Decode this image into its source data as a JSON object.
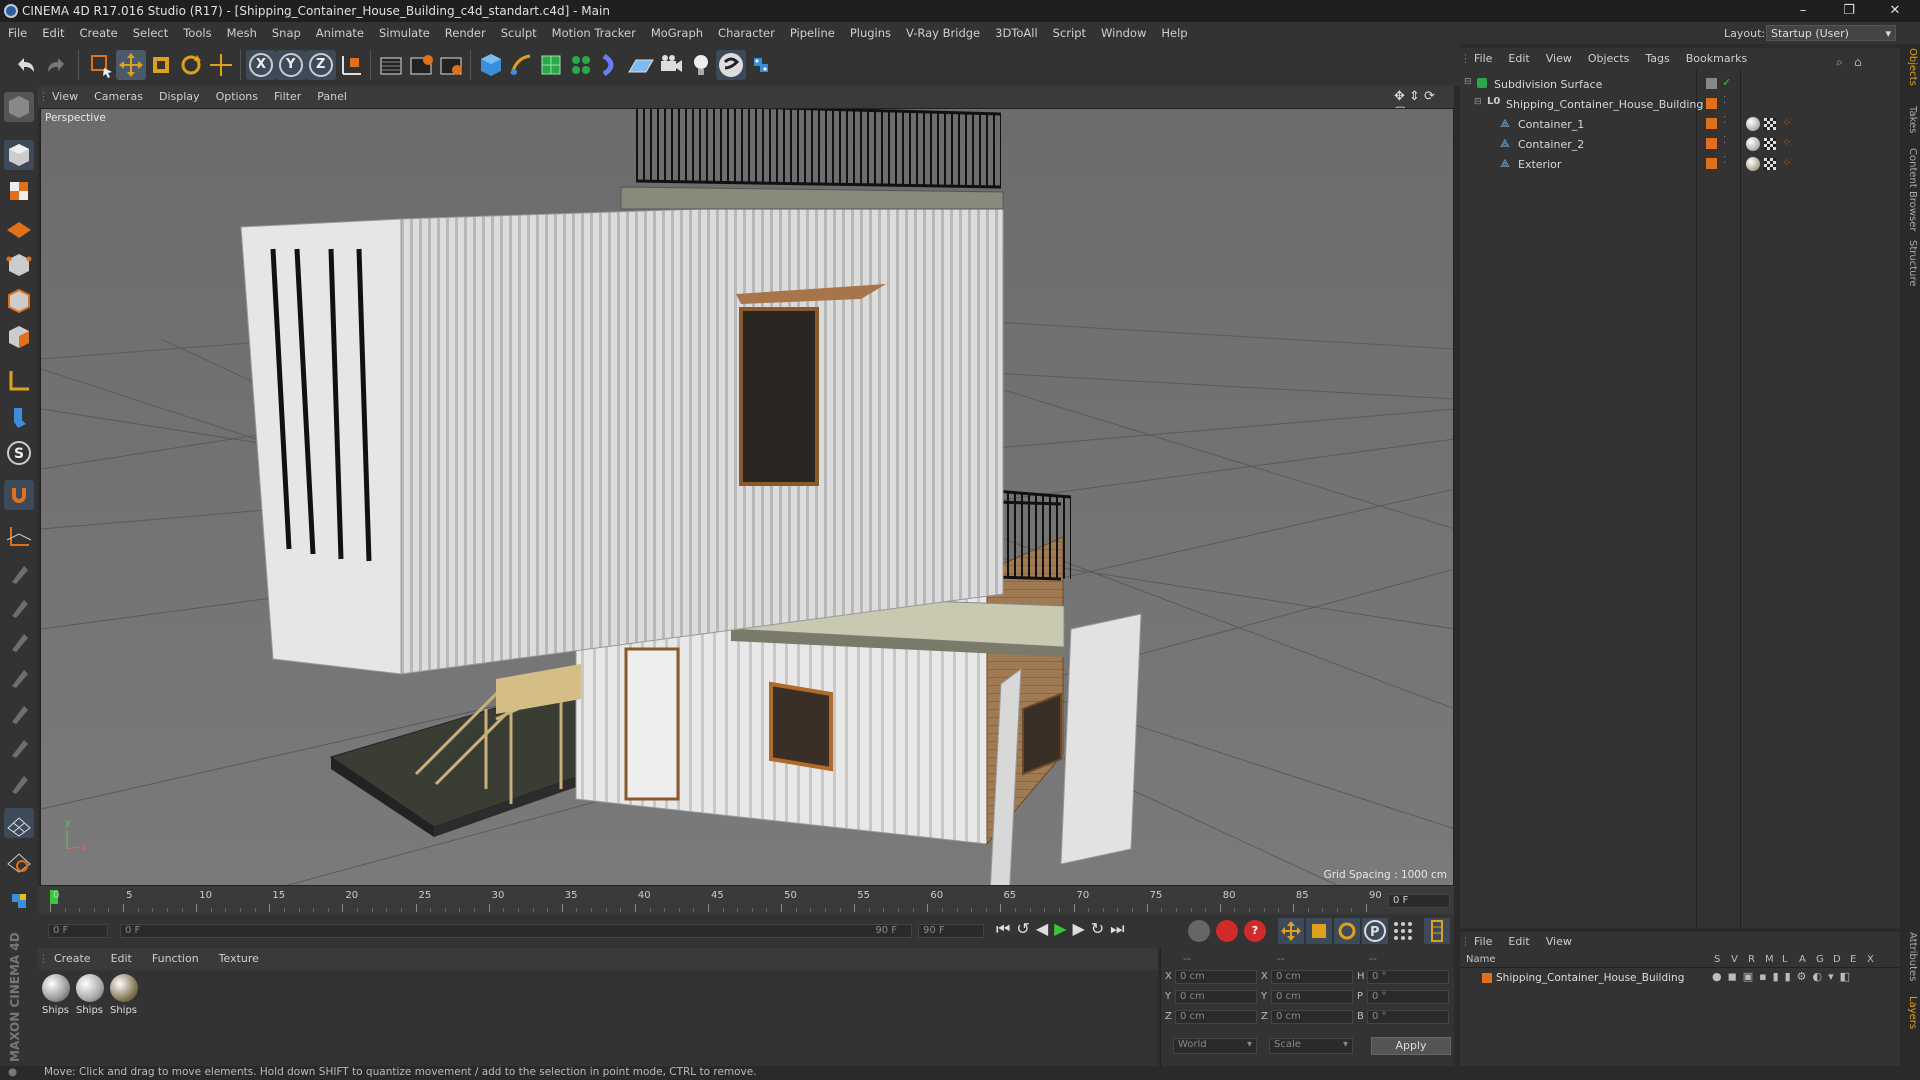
{
  "app": {
    "title": "CINEMA 4D R17.016 Studio (R17) - [Shipping_Container_House_Building_c4d_standart.c4d] - Main",
    "window_controls": [
      "–",
      "❐",
      "✕"
    ]
  },
  "menu": [
    "File",
    "Edit",
    "Create",
    "Select",
    "Tools",
    "Mesh",
    "Snap",
    "Animate",
    "Simulate",
    "Render",
    "Sculpt",
    "Motion Tracker",
    "MoGraph",
    "Character",
    "Pipeline",
    "Plugins",
    "V-Ray Bridge",
    "3DToAll",
    "Script",
    "Window",
    "Help"
  ],
  "layout": {
    "label": "Layout:",
    "value": "Startup (User)"
  },
  "toolbar_icons": [
    "undo-icon",
    "redo-icon",
    "live-selection-icon",
    "move-icon",
    "scale-icon",
    "rotate-icon",
    "add-icon",
    "x-axis-icon",
    "y-axis-icon",
    "z-axis-icon",
    "coordinate-system-icon",
    "render-view-icon",
    "render-picture-viewer-icon",
    "render-settings-icon",
    "cube-icon",
    "pen-icon",
    "subdivision-icon",
    "cloner-icon",
    "deformer-icon",
    "floor-icon",
    "camera-icon",
    "light-icon",
    "python-generator-icon",
    "script-icon"
  ],
  "toolbar_axis": [
    "X",
    "Y",
    "Z"
  ],
  "viewport": {
    "menu": [
      "View",
      "Cameras",
      "Display",
      "Options",
      "Filter",
      "Panel"
    ],
    "label": "Perspective",
    "grid_spacing": "Grid Spacing : 1000 cm"
  },
  "timeline": {
    "ticks": [
      "0",
      "5",
      "10",
      "15",
      "20",
      "25",
      "30",
      "35",
      "40",
      "45",
      "50",
      "55",
      "60",
      "65",
      "70",
      "75",
      "80",
      "85",
      "90"
    ],
    "current_frame_right": "0 F",
    "start_frame": "0 F",
    "range_start": "0 F",
    "range_end": "90 F",
    "end_frame": "90 F"
  },
  "materials": {
    "menu": [
      "Create",
      "Edit",
      "Function",
      "Texture"
    ],
    "items": [
      "Ships",
      "Ships",
      "Ships"
    ]
  },
  "coords": {
    "headers": [
      "--",
      "--",
      "--"
    ],
    "rows": [
      {
        "a": "X",
        "av": "0 cm",
        "b": "X",
        "bv": "0 cm",
        "c": "H",
        "cv": "0 °"
      },
      {
        "a": "Y",
        "av": "0 cm",
        "b": "Y",
        "bv": "0 cm",
        "c": "P",
        "cv": "0 °"
      },
      {
        "a": "Z",
        "av": "0 cm",
        "b": "Z",
        "bv": "0 cm",
        "c": "B",
        "cv": "0 °"
      }
    ],
    "world": "World",
    "scale": "Scale",
    "apply": "Apply"
  },
  "objects_panel": {
    "menu": [
      "File",
      "Edit",
      "View",
      "Objects",
      "Tags",
      "Bookmarks"
    ],
    "items": [
      {
        "name": "Subdivision Surface"
      },
      {
        "name": "Shipping_Container_House_Building"
      },
      {
        "name": "Container_1"
      },
      {
        "name": "Container_2"
      },
      {
        "name": "Exterior"
      }
    ]
  },
  "attributes_panel": {
    "menu": [
      "File",
      "Edit",
      "View"
    ],
    "columns": [
      "Name",
      "S",
      "V",
      "R",
      "M",
      "L",
      "A",
      "G",
      "D",
      "E",
      "X"
    ],
    "row_name": "Shipping_Container_House_Building"
  },
  "side_tabs": [
    "Objects",
    "Takes",
    "Content Browser",
    "Structure",
    "Attributes",
    "Layers"
  ],
  "brand": "MAXON CINEMA 4D",
  "status": "Move: Click and drag to move elements. Hold down SHIFT to quantize movement / add to the selection in point mode, CTRL to remove.",
  "colors": {
    "accent_orange": "#e0701c",
    "accent_blue": "#3b8ed8",
    "play_green": "#37c837"
  }
}
